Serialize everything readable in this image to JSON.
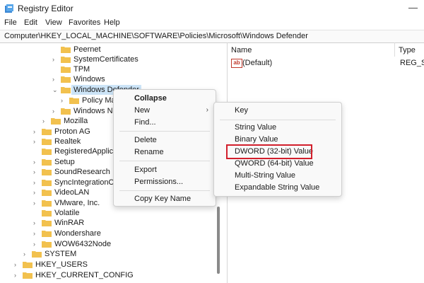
{
  "window": {
    "title": "Registry Editor",
    "minimize_glyph": "—"
  },
  "menubar": [
    "File",
    "Edit",
    "View",
    "Favorites",
    "Help"
  ],
  "address": "Computer\\HKEY_LOCAL_MACHINE\\SOFTWARE\\Policies\\Microsoft\\Windows Defender",
  "tree": {
    "items": [
      {
        "label": "Peernet"
      },
      {
        "label": "SystemCertificates"
      },
      {
        "label": "TPM"
      },
      {
        "label": "Windows"
      },
      {
        "label": "Windows Defender"
      },
      {
        "label": "Policy Mar"
      },
      {
        "label": "Windows NT"
      },
      {
        "label": "Mozilla"
      },
      {
        "label": "Proton AG"
      },
      {
        "label": "Realtek"
      },
      {
        "label": "RegisteredApplicat"
      },
      {
        "label": "Setup"
      },
      {
        "label": "SoundResearch"
      },
      {
        "label": "SyncIntegrationClie"
      },
      {
        "label": "VideoLAN"
      },
      {
        "label": "VMware, Inc."
      },
      {
        "label": "Volatile"
      },
      {
        "label": "WinRAR"
      },
      {
        "label": "Wondershare"
      },
      {
        "label": "WOW6432Node"
      },
      {
        "label": "SYSTEM"
      },
      {
        "label": "HKEY_USERS"
      },
      {
        "label": "HKEY_CURRENT_CONFIG"
      }
    ]
  },
  "values_pane": {
    "headers": {
      "name": "Name",
      "type": "Type"
    },
    "rows": [
      {
        "icon": "ab",
        "name": "(Default)",
        "type": "REG_SZ"
      }
    ]
  },
  "context_menu": {
    "items": [
      "Collapse",
      "New",
      "Find...",
      "Delete",
      "Rename",
      "Export",
      "Permissions...",
      "Copy Key Name"
    ]
  },
  "new_submenu": {
    "items": [
      "Key",
      "String Value",
      "Binary Value",
      "DWORD (32-bit) Value",
      "QWORD (64-bit) Value",
      "Multi-String Value",
      "Expandable String Value"
    ],
    "highlighted": "DWORD (32-bit) Value"
  },
  "colors": {
    "folder": "#f2c14e",
    "highlight_box": "#d21f2c",
    "selection": "#cce4f7"
  },
  "icons": {
    "folder": "folder-icon",
    "chevron_right": "chevron-right-icon",
    "chevron_down": "chevron-down-icon",
    "app": "registry-editor-icon"
  }
}
